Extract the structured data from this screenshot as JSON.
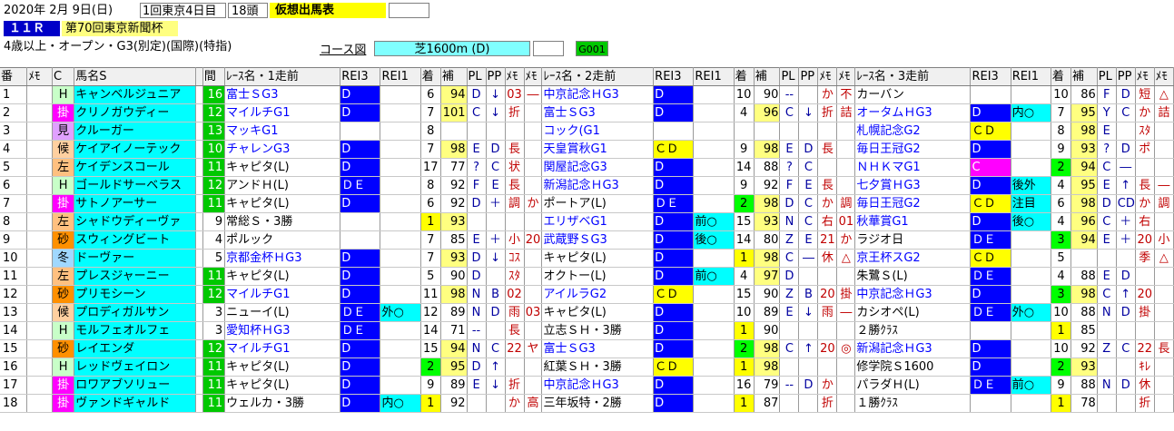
{
  "header": {
    "date": "2020年 2月 9日(日)",
    "meeting": "1回東京4日目",
    "heads": "18頭",
    "kaso": "仮想出馬表",
    "race_no": "１１Ｒ",
    "race_name": "第70回東京新聞杯",
    "conditions": "4歳以上・オープン・G3(別定)(国際)(特指)",
    "course_label": "コース図",
    "course": "芝1600m (D)",
    "code": "G001"
  },
  "columns": [
    "番",
    "ﾒﾓ",
    "C",
    "馬名S",
    "",
    "間",
    "ﾚｰｽ名・1走前",
    "REI3",
    "REI1",
    "着",
    "補",
    "PL",
    "PP",
    "ﾒﾓ",
    "ﾒﾓ",
    "ﾚｰｽ名・2走前",
    "REI3",
    "REI1",
    "着",
    "補",
    "PL",
    "PP",
    "ﾒﾓ",
    "ﾒﾓ",
    "ﾚｰｽ名・3走前",
    "REI3",
    "REI1",
    "着",
    "補",
    "PL",
    "PP",
    "ﾒﾓ",
    "ﾒﾓ"
  ],
  "rows": [
    {
      "no": "1",
      "memo": "",
      "mark": "H",
      "name": "キャンベルジュニア",
      "kan": "16",
      "r1": {
        "n": "富士ＳG3",
        "e3": "D",
        "e1": "",
        "ch": "6",
        "h": "94",
        "pl": "D",
        "pp": "↓",
        "m1": "03",
        "m2": "―"
      },
      "r2": {
        "n": "中京記念ＨG3",
        "e3": "D",
        "e1": "",
        "ch": "10",
        "h": "90",
        "pl": "--",
        "pp": "",
        "m1": "か",
        "m2": "不"
      },
      "r3": {
        "n": "カーバン",
        "e3": "",
        "e1": "",
        "ch": "10",
        "h": "86",
        "pl": "F",
        "pp": "D",
        "m1": "短",
        "m2": "△"
      }
    },
    {
      "no": "2",
      "memo": "",
      "mark": "掛",
      "name": "クリノガウディー",
      "kan": "12",
      "r1": {
        "n": "マイルチG1",
        "e3": "D",
        "e1": "",
        "ch": "7",
        "h": "101",
        "pl": "C",
        "pp": "↓",
        "m1": "折",
        "m2": ""
      },
      "r2": {
        "n": "富士ＳG3",
        "e3": "D",
        "e1": "",
        "ch": "4",
        "h": "96",
        "pl": "C",
        "pp": "↓",
        "m1": "折",
        "m2": "詰"
      },
      "r3": {
        "n": "オータムＨG3",
        "e3": "D",
        "e1": "内○",
        "ch": "7",
        "h": "95",
        "pl": "Y",
        "pp": "C",
        "m1": "か",
        "m2": "詰"
      }
    },
    {
      "no": "3",
      "memo": "",
      "mark": "見",
      "name": "クルーガー",
      "kan": "13",
      "r1": {
        "n": "マッキG1",
        "e3": "",
        "e1": "",
        "ch": "8",
        "h": "",
        "pl": "",
        "pp": "",
        "m1": "",
        "m2": ""
      },
      "r2": {
        "n": "コック(G1",
        "e3": "",
        "e1": "",
        "ch": "",
        "h": "",
        "pl": "",
        "pp": "",
        "m1": "",
        "m2": ""
      },
      "r3": {
        "n": "札幌記念G2",
        "e3": "ＣＤ",
        "e1": "",
        "ch": "8",
        "h": "98",
        "pl": "E",
        "pp": "",
        "m1": "ｽﾀ",
        "m2": ""
      }
    },
    {
      "no": "4",
      "memo": "",
      "mark": "候",
      "name": "ケイアイノーテック",
      "kan": "10",
      "r1": {
        "n": "チャレンG3",
        "e3": "D",
        "e1": "",
        "ch": "7",
        "h": "98",
        "pl": "E",
        "pp": "D",
        "m1": "長",
        "m2": ""
      },
      "r2": {
        "n": "天皇賞秋G1",
        "e3": "ＣＤ",
        "e1": "",
        "ch": "9",
        "h": "98",
        "pl": "E",
        "pp": "D",
        "m1": "長",
        "m2": ""
      },
      "r3": {
        "n": "毎日王冠G2",
        "e3": "D",
        "e1": "",
        "ch": "9",
        "h": "93",
        "pl": "?",
        "pp": "D",
        "m1": "ポ",
        "m2": ""
      }
    },
    {
      "no": "5",
      "memo": "",
      "mark": "左",
      "name": "ケイデンスコール",
      "kan": "11",
      "r1": {
        "n": "キャピタ(L)",
        "e3": "D",
        "e1": "",
        "ch": "17",
        "h": "77",
        "pl": "?",
        "pp": "C",
        "m1": "状",
        "m2": ""
      },
      "r2": {
        "n": "関屋記念G3",
        "e3": "D",
        "e1": "",
        "ch": "14",
        "h": "88",
        "pl": "?",
        "pp": "C",
        "m1": "",
        "m2": ""
      },
      "r3": {
        "n": "ＮＨＫマG1",
        "e3": "C",
        "e1": "",
        "ch": "2",
        "h": "94",
        "pl": "C",
        "pp": "―",
        "m1": "",
        "m2": ""
      }
    },
    {
      "no": "6",
      "memo": "",
      "mark": "H",
      "name": "ゴールドサーベラス",
      "kan": "12",
      "r1": {
        "n": "アンドＨ(L)",
        "e3": "ＤＥ",
        "e1": "",
        "ch": "8",
        "h": "92",
        "pl": "F",
        "pp": "E",
        "m1": "長",
        "m2": ""
      },
      "r2": {
        "n": "新潟記念ＨG3",
        "e3": "D",
        "e1": "",
        "ch": "9",
        "h": "92",
        "pl": "F",
        "pp": "E",
        "m1": "長",
        "m2": ""
      },
      "r3": {
        "n": "七夕賞ＨG3",
        "e3": "D",
        "e1": "後外",
        "ch": "4",
        "h": "95",
        "pl": "E",
        "pp": "↑",
        "m1": "長",
        "m2": "―"
      }
    },
    {
      "no": "7",
      "memo": "",
      "mark": "掛",
      "name": "サトノアーサー",
      "kan": "11",
      "r1": {
        "n": "キャピタ(L)",
        "e3": "D",
        "e1": "",
        "ch": "6",
        "h": "92",
        "pl": "D",
        "pp": "＋",
        "m1": "調",
        "m2": "か"
      },
      "r2": {
        "n": "ポートア(L)",
        "e3": "ＤＥ",
        "e1": "",
        "ch": "2",
        "h": "98",
        "pl": "D",
        "pp": "C",
        "m1": "か",
        "m2": "調"
      },
      "r3": {
        "n": "毎日王冠G2",
        "e3": "ＣＤ",
        "e1": "注目",
        "ch": "6",
        "h": "98",
        "pl": "D",
        "pp": "CD",
        "m1": "か",
        "m2": "調"
      }
    },
    {
      "no": "8",
      "memo": "",
      "mark": "左",
      "name": "シャドウディーヴァ",
      "kan": "9",
      "r1": {
        "n": "常総Ｓ・3勝",
        "e3": "",
        "e1": "",
        "ch": "1",
        "h": "93",
        "pl": "",
        "pp": "",
        "m1": "",
        "m2": ""
      },
      "r2": {
        "n": "エリザベG1",
        "e3": "D",
        "e1": "前○",
        "ch": "15",
        "h": "93",
        "pl": "N",
        "pp": "C",
        "m1": "右",
        "m2": "01"
      },
      "r3": {
        "n": "秋華賞G1",
        "e3": "D",
        "e1": "後○",
        "ch": "4",
        "h": "96",
        "pl": "C",
        "pp": "＋",
        "m1": "右",
        "m2": ""
      }
    },
    {
      "no": "9",
      "memo": "",
      "mark": "砂",
      "name": "スウィングビート",
      "kan": "4",
      "r1": {
        "n": "ポルック",
        "e3": "",
        "e1": "",
        "ch": "7",
        "h": "85",
        "pl": "E",
        "pp": "＋",
        "m1": "小",
        "m2": "20"
      },
      "r2": {
        "n": "武蔵野ＳG3",
        "e3": "D",
        "e1": "後○",
        "ch": "14",
        "h": "80",
        "pl": "Z",
        "pp": "E",
        "m1": "21",
        "m2": "か"
      },
      "r3": {
        "n": "ラジオ日",
        "e3": "ＤＥ",
        "e1": "",
        "ch": "3",
        "h": "94",
        "pl": "E",
        "pp": "＋",
        "m1": "20",
        "m2": "小"
      }
    },
    {
      "no": "10",
      "memo": "",
      "mark": "冬",
      "name": "ドーヴァー",
      "kan": "5",
      "r1": {
        "n": "京都金杯ＨG3",
        "e3": "D",
        "e1": "",
        "ch": "7",
        "h": "93",
        "pl": "D",
        "pp": "↓",
        "m1": "ｺｽ",
        "m2": ""
      },
      "r2": {
        "n": "キャピタ(L)",
        "e3": "D",
        "e1": "",
        "ch": "1",
        "h": "98",
        "pl": "C",
        "pp": "―",
        "m1": "休",
        "m2": "△"
      },
      "r3": {
        "n": "京王杯スG2",
        "e3": "ＣＤ",
        "e1": "",
        "ch": "5",
        "h": "",
        "pl": "",
        "pp": "",
        "m1": "季",
        "m2": "△"
      }
    },
    {
      "no": "11",
      "memo": "",
      "mark": "左",
      "name": "プレスジャーニー",
      "kan": "11",
      "r1": {
        "n": "キャピタ(L)",
        "e3": "D",
        "e1": "",
        "ch": "5",
        "h": "90",
        "pl": "D",
        "pp": "",
        "m1": "ｽﾀ",
        "m2": ""
      },
      "r2": {
        "n": "オクトー(L)",
        "e3": "D",
        "e1": "前○",
        "ch": "4",
        "h": "97",
        "pl": "D",
        "pp": "",
        "m1": "",
        "m2": ""
      },
      "r3": {
        "n": "朱鷺Ｓ(L)",
        "e3": "ＤＥ",
        "e1": "",
        "ch": "4",
        "h": "88",
        "pl": "E",
        "pp": "D",
        "m1": "",
        "m2": ""
      }
    },
    {
      "no": "12",
      "memo": "",
      "mark": "砂",
      "name": "プリモシーン",
      "kan": "12",
      "r1": {
        "n": "マイルチG1",
        "e3": "D",
        "e1": "",
        "ch": "11",
        "h": "98",
        "pl": "N",
        "pp": "B",
        "m1": "02",
        "m2": ""
      },
      "r2": {
        "n": "アイルラG2",
        "e3": "ＣＤ",
        "e1": "",
        "ch": "15",
        "h": "90",
        "pl": "Z",
        "pp": "B",
        "m1": "20",
        "m2": "掛"
      },
      "r3": {
        "n": "中京記念ＨG3",
        "e3": "D",
        "e1": "",
        "ch": "3",
        "h": "98",
        "pl": "C",
        "pp": "↑",
        "m1": "20",
        "m2": ""
      }
    },
    {
      "no": "13",
      "memo": "",
      "mark": "候",
      "name": "プロディガルサン",
      "kan": "3",
      "r1": {
        "n": "ニューイ(L)",
        "e3": "ＤＥ",
        "e1": "外○",
        "ch": "12",
        "h": "89",
        "pl": "N",
        "pp": "D",
        "m1": "雨",
        "m2": "03"
      },
      "r2": {
        "n": "キャピタ(L)",
        "e3": "D",
        "e1": "",
        "ch": "10",
        "h": "89",
        "pl": "E",
        "pp": "↓",
        "m1": "雨",
        "m2": "―"
      },
      "r3": {
        "n": "カシオペ(L)",
        "e3": "ＤＥ",
        "e1": "外○",
        "ch": "10",
        "h": "88",
        "pl": "N",
        "pp": "D",
        "m1": "掛",
        "m2": ""
      }
    },
    {
      "no": "14",
      "memo": "",
      "mark": "H",
      "name": "モルフェオルフェ",
      "kan": "3",
      "r1": {
        "n": "愛知杯ＨG3",
        "e3": "ＤＥ",
        "e1": "",
        "ch": "14",
        "h": "71",
        "pl": "--",
        "pp": "",
        "m1": "長",
        "m2": ""
      },
      "r2": {
        "n": "立志ＳＨ・3勝",
        "e3": "D",
        "e1": "",
        "ch": "1",
        "h": "90",
        "pl": "",
        "pp": "",
        "m1": "",
        "m2": ""
      },
      "r3": {
        "n": "２勝ｸﾗｽ",
        "e3": "",
        "e1": "",
        "ch": "1",
        "h": "85",
        "pl": "",
        "pp": "",
        "m1": "",
        "m2": ""
      }
    },
    {
      "no": "15",
      "memo": "",
      "mark": "砂",
      "name": "レイエンダ",
      "kan": "12",
      "r1": {
        "n": "マイルチG1",
        "e3": "D",
        "e1": "",
        "ch": "15",
        "h": "94",
        "pl": "N",
        "pp": "C",
        "m1": "22",
        "m2": "ヤ"
      },
      "r2": {
        "n": "富士ＳG3",
        "e3": "D",
        "e1": "",
        "ch": "2",
        "h": "98",
        "pl": "C",
        "pp": "↑",
        "m1": "20",
        "m2": "◎"
      },
      "r3": {
        "n": "新潟記念ＨG3",
        "e3": "D",
        "e1": "",
        "ch": "10",
        "h": "92",
        "pl": "Z",
        "pp": "C",
        "m1": "22",
        "m2": "長"
      }
    },
    {
      "no": "16",
      "memo": "",
      "mark": "H",
      "name": "レッドヴェイロン",
      "kan": "11",
      "r1": {
        "n": "キャピタ(L)",
        "e3": "D",
        "e1": "",
        "ch": "2",
        "h": "95",
        "pl": "D",
        "pp": "↑",
        "m1": "",
        "m2": ""
      },
      "r2": {
        "n": "紅葉ＳＨ・3勝",
        "e3": "ＣＤ",
        "e1": "",
        "ch": "1",
        "h": "98",
        "pl": "",
        "pp": "",
        "m1": "",
        "m2": ""
      },
      "r3": {
        "n": "修学院Ｓ1600",
        "e3": "D",
        "e1": "",
        "ch": "2",
        "h": "93",
        "pl": "",
        "pp": "",
        "m1": "ｷﾚ",
        "m2": ""
      }
    },
    {
      "no": "17",
      "memo": "",
      "mark": "掛",
      "name": "ロワアブソリュー",
      "kan": "11",
      "r1": {
        "n": "キャピタ(L)",
        "e3": "D",
        "e1": "",
        "ch": "9",
        "h": "89",
        "pl": "E",
        "pp": "↓",
        "m1": "折",
        "m2": ""
      },
      "r2": {
        "n": "中京記念ＨG3",
        "e3": "D",
        "e1": "",
        "ch": "16",
        "h": "79",
        "pl": "--",
        "pp": "D",
        "m1": "か",
        "m2": ""
      },
      "r3": {
        "n": "パラダＨ(L)",
        "e3": "ＤＥ",
        "e1": "前○",
        "ch": "9",
        "h": "88",
        "pl": "N",
        "pp": "D",
        "m1": "休",
        "m2": ""
      }
    },
    {
      "no": "18",
      "memo": "",
      "mark": "掛",
      "name": "ヴァンドギャルド",
      "kan": "11",
      "r1": {
        "n": "ウェルカ・3勝",
        "e3": "D",
        "e1": "内○",
        "ch": "1",
        "h": "92",
        "pl": "",
        "pp": "",
        "m1": "か",
        "m2": "高"
      },
      "r2": {
        "n": "三年坂特・2勝",
        "e3": "D",
        "e1": "",
        "ch": "1",
        "h": "87",
        "pl": "",
        "pp": "",
        "m1": "折",
        "m2": ""
      },
      "r3": {
        "n": "１勝ｸﾗｽ",
        "e3": "",
        "e1": "",
        "ch": "1",
        "h": "78",
        "pl": "",
        "pp": "",
        "m1": "折",
        "m2": ""
      }
    }
  ]
}
